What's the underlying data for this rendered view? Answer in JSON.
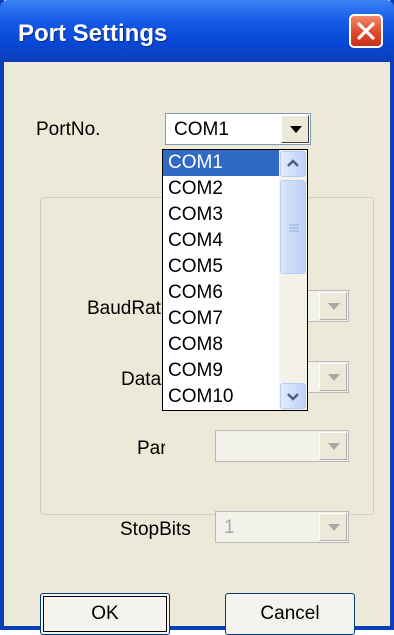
{
  "dialog": {
    "title": "Port Settings",
    "close_icon": "close-x-icon"
  },
  "port": {
    "label": "PortNo.",
    "value": "COM1",
    "dropdown_open": true,
    "options": [
      "COM1",
      "COM2",
      "COM3",
      "COM4",
      "COM5",
      "COM6",
      "COM7",
      "COM8",
      "COM9",
      "COM10"
    ],
    "selected_index": 0
  },
  "settings": {
    "baud_label": "BaudRate",
    "databits_label": "DataBits",
    "parity_label": "Parity",
    "stopbits_label": "StopBits",
    "stopbits_value": "1"
  },
  "buttons": {
    "ok": "OK",
    "cancel": "Cancel"
  },
  "colors": {
    "titlebar": "#0a3fb8",
    "selection": "#316ac5",
    "close_button": "#e0492a"
  }
}
